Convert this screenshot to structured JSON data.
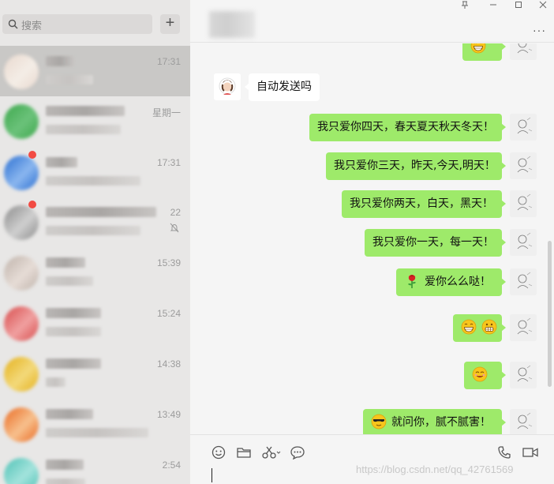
{
  "search": {
    "placeholder": "搜索",
    "add_label": "+"
  },
  "chat_list": [
    {
      "time": "17:31",
      "active": true,
      "unread": false,
      "muted": false,
      "avatar_colors": [
        "#e9d9cf",
        "#f4ede6"
      ]
    },
    {
      "time": "星期一",
      "active": false,
      "unread": false,
      "muted": false,
      "avatar_colors": [
        "#3ea84d",
        "#6bc27a"
      ]
    },
    {
      "time": "17:31",
      "active": false,
      "unread": true,
      "muted": false,
      "avatar_colors": [
        "#2b6fd1",
        "#8ab6ef"
      ]
    },
    {
      "time": "22",
      "active": false,
      "unread": true,
      "muted": true,
      "avatar_colors": [
        "#8b8b8b",
        "#cfcfcf"
      ]
    },
    {
      "time": "15:39",
      "active": false,
      "unread": false,
      "muted": false,
      "avatar_colors": [
        "#bfb3ab",
        "#e6dcd6"
      ]
    },
    {
      "time": "15:24",
      "active": false,
      "unread": false,
      "muted": false,
      "avatar_colors": [
        "#d84c4c",
        "#f0a0a0"
      ]
    },
    {
      "time": "14:38",
      "active": false,
      "unread": false,
      "muted": false,
      "avatar_colors": [
        "#e5b11c",
        "#f3d97a"
      ]
    },
    {
      "time": "13:49",
      "active": false,
      "unread": false,
      "muted": false,
      "avatar_colors": [
        "#ea6a22",
        "#f7c08d"
      ]
    },
    {
      "time": "2:54",
      "active": false,
      "unread": false,
      "muted": false,
      "avatar_colors": [
        "#4fc2b6",
        "#a3e3dc"
      ]
    }
  ],
  "header": {
    "more_label": "···"
  },
  "messages": [
    {
      "side": "out",
      "text": "",
      "emoji": [
        "grin-emoji"
      ]
    },
    {
      "side": "in",
      "text": "自动发送吗"
    },
    {
      "side": "out",
      "text": "我只爱你四天，春天夏天秋天冬天！"
    },
    {
      "side": "out",
      "text": "我只爱你三天，昨天,今天,明天！"
    },
    {
      "side": "out",
      "text": "我只爱你两天，白天，黑天！"
    },
    {
      "side": "out",
      "text": "我只爱你一天，每一天！"
    },
    {
      "side": "out",
      "text": "爱你么么哒！",
      "emoji": [
        "rose-emoji"
      ]
    },
    {
      "side": "out",
      "text": "",
      "emoji": [
        "grin-emoji",
        "grimace-emoji"
      ]
    },
    {
      "side": "out",
      "text": "",
      "emoji": [
        "smirk-emoji"
      ]
    },
    {
      "side": "out",
      "text": "就问你，腻不腻害！",
      "emoji": [
        "cool-emoji"
      ]
    }
  ],
  "composer": {
    "watermark": "https://blog.csdn.net/qq_42761569"
  },
  "colors": {
    "bubble_out": "#9eea6a",
    "bubble_in": "#ffffff",
    "unread": "#f24b43"
  }
}
